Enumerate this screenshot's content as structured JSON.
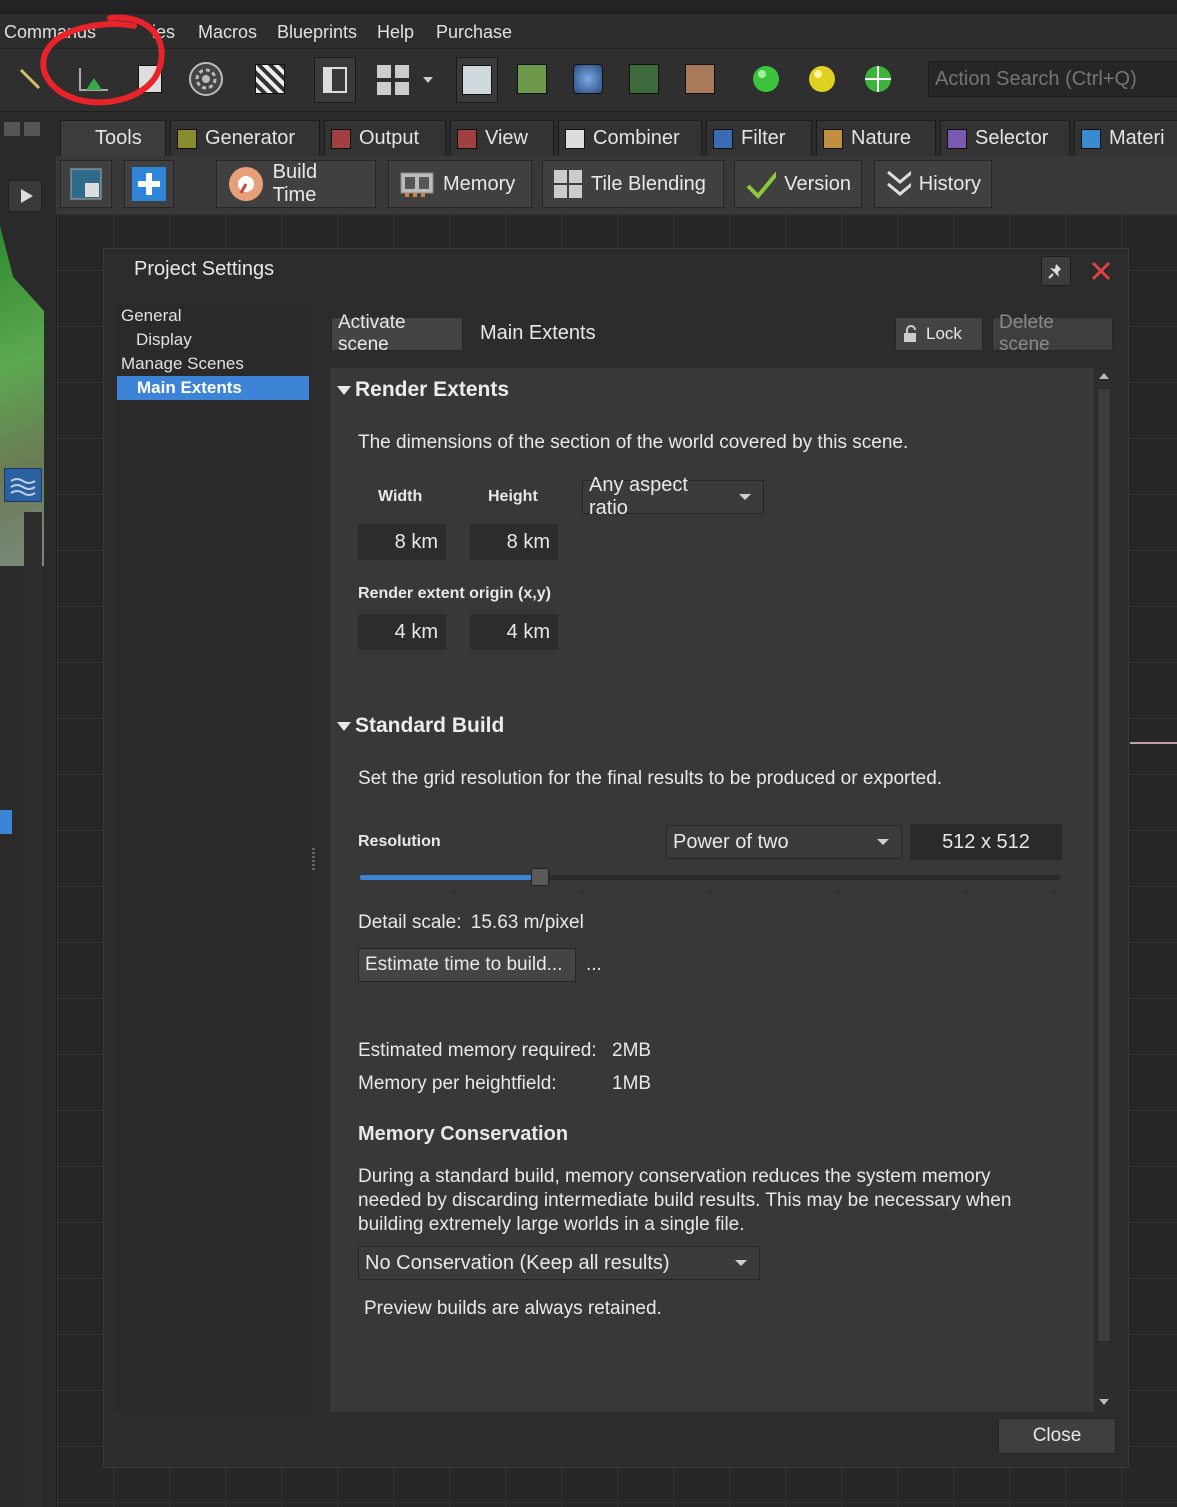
{
  "menu": [
    "Commands",
    "ies",
    "Macros",
    "Blueprints",
    "Help",
    "Purchase"
  ],
  "search": {
    "placeholder": "Action Search (Ctrl+Q)"
  },
  "tabs": [
    "Tools",
    "Generator",
    "Output",
    "View",
    "Combiner",
    "Filter",
    "Nature",
    "Selector",
    "Materi"
  ],
  "subtoolbar": [
    "Build Time",
    "Memory",
    "Tile Blending",
    "Version",
    "History"
  ],
  "dialog": {
    "title": "Project Settings",
    "nav": [
      "General",
      "Display",
      "Manage Scenes",
      "Main Extents"
    ],
    "activate_scene": "Activate scene",
    "scene_name": "Main Extents",
    "lock": "Lock",
    "delete_scene": "Delete scene",
    "render_extents": {
      "title": "Render Extents",
      "description": "The dimensions of the section of the world covered by this scene.",
      "width_label": "Width",
      "height_label": "Height",
      "aspect_ratio": "Any aspect ratio",
      "width": "8 km",
      "height": "8 km",
      "origin_label": "Render extent origin (x,y)",
      "origin_x": "4 km",
      "origin_y": "4 km"
    },
    "standard_build": {
      "title": "Standard Build",
      "description": "Set the grid resolution for the final results to be produced or exported.",
      "resolution_label": "Resolution",
      "resolution_mode": "Power of two",
      "resolution_value": "512 x 512",
      "slider_fraction": 0.257,
      "detail_scale_label": "Detail scale:",
      "detail_scale_value": "15.63 m/pixel",
      "estimate_button": "Estimate time to build...",
      "estimate_result": "...",
      "mem_required_label": "Estimated memory required:",
      "mem_required_value": "2MB",
      "mem_per_hf_label": "Memory per heightfield:",
      "mem_per_hf_value": "1MB"
    },
    "memory_conservation": {
      "title": "Memory Conservation",
      "description": "During a standard build, memory conservation reduces the system memory needed by discarding intermediate build results. This may be necessary when building extremely large worlds in a single file.",
      "mode": "No Conservation (Keep all results)",
      "note": "Preview builds are always retained."
    },
    "close": "Close"
  },
  "colors": {
    "accent": "#3d84d6",
    "annotation": "#e8232a",
    "close_x": "#e04040"
  }
}
